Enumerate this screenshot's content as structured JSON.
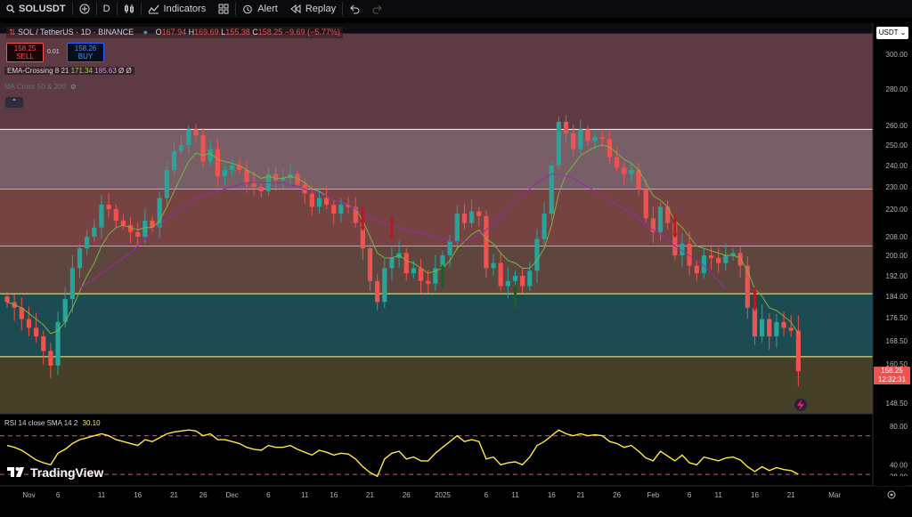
{
  "toolbar": {
    "symbol": "SOLUSDT",
    "interval": "D",
    "indicators": "Indicators",
    "alert": "Alert",
    "replay": "Replay"
  },
  "legend": {
    "title": "SOL / TetherUS · 1D · BINANCE",
    "open_label": "O",
    "open": "167.94",
    "high_label": "H",
    "high": "169.69",
    "low_label": "L",
    "low": "155.38",
    "close_label": "C",
    "close": "158.25",
    "change": "−9.69 (−5.77%)"
  },
  "trade": {
    "sell_price": "158.25",
    "sell_label": "SELL",
    "spread": "0.01",
    "buy_price": "158.26",
    "buy_label": "BUY"
  },
  "indicators": [
    {
      "name": "EMA-Crossing 8 21",
      "v1": "171.34",
      "v2": "185.63",
      "v3": "Ø Ø"
    },
    {
      "name": "MA Cross 50 & 200"
    }
  ],
  "price_axis": {
    "currency": "USDT",
    "ticks": [
      "300.00",
      "280.00",
      "260.00",
      "250.00",
      "240.00",
      "230.00",
      "220.00",
      "208.00",
      "200.00",
      "192.00",
      "184.00",
      "176.50",
      "168.50",
      "160.50",
      "148.50"
    ],
    "last_price": "158.25",
    "countdown": "12:32:31"
  },
  "rsi": {
    "label": "RSI 14 close SMA 14 2",
    "value": "30.10",
    "ticks": [
      "80.00",
      "40.00",
      "28.00"
    ]
  },
  "time_axis": {
    "labels": [
      "Nov",
      "6",
      "11",
      "16",
      "21",
      "26",
      "Dec",
      "6",
      "11",
      "16",
      "21",
      "26",
      "2025",
      "6",
      "11",
      "16",
      "21",
      "26",
      "Feb",
      "6",
      "11",
      "16",
      "21",
      "Mar"
    ]
  },
  "logo": "TradingView",
  "colors": {
    "up": "#26a69a",
    "down": "#ef5350",
    "ema_fast": "#7cb342",
    "ema_slow": "#9c27b0",
    "rsi": "#ffeb3b",
    "level_line": "#fff59d"
  },
  "chart_data": {
    "type": "candlestick",
    "symbol": "SOL / TetherUS",
    "interval": "1D",
    "price_range": [
      143,
      312
    ],
    "horizontal_levels": [
      258,
      229,
      204,
      185,
      163
    ],
    "zones": [
      {
        "from": 258,
        "to": 312,
        "color": "#7a4a55"
      },
      {
        "from": 229,
        "to": 258,
        "color": "#9c7a86"
      },
      {
        "from": 204,
        "to": 229,
        "color": "#9a5656"
      },
      {
        "from": 185,
        "to": 204,
        "color": "#7a5a50"
      },
      {
        "from": 163,
        "to": 185,
        "color": "#23606a"
      },
      {
        "from": 143,
        "to": 163,
        "color": "#5a5232"
      }
    ],
    "closes": [
      182,
      180,
      176,
      173,
      170,
      165,
      160,
      175,
      183,
      195,
      203,
      208,
      212,
      222,
      220,
      215,
      213,
      210,
      208,
      215,
      212,
      225,
      238,
      247,
      250,
      258,
      255,
      242,
      248,
      235,
      238,
      240,
      238,
      232,
      230,
      228,
      236,
      233,
      234,
      236,
      231,
      227,
      221,
      225,
      222,
      218,
      222,
      221,
      214,
      203,
      190,
      182,
      195,
      199,
      201,
      193,
      195,
      190,
      189,
      195,
      200,
      206,
      218,
      214,
      219,
      217,
      195,
      197,
      188,
      190,
      192,
      188,
      194,
      207,
      218,
      240,
      262,
      256,
      248,
      258,
      252,
      254,
      253,
      244,
      239,
      236,
      238,
      229,
      216,
      210,
      221,
      214,
      200,
      205,
      196,
      193,
      200,
      199,
      197,
      200,
      201,
      196,
      180,
      170,
      176,
      170,
      175,
      173,
      172,
      158.25
    ],
    "sell_signals": [
      49,
      53,
      92,
      103
    ],
    "buy_signals": [
      60,
      70
    ],
    "ema_fast": [
      182,
      181,
      180,
      178,
      176,
      174,
      171,
      172,
      175,
      180,
      186,
      192,
      197,
      204,
      209,
      212,
      213,
      212,
      211,
      212,
      212,
      215,
      221,
      228,
      235,
      242,
      246,
      245,
      246,
      243,
      242,
      241,
      240,
      238,
      236,
      234,
      235,
      234,
      234,
      235,
      234,
      232,
      229,
      228,
      226,
      224,
      223,
      222,
      220,
      215,
      208,
      201,
      199,
      199,
      200,
      198,
      197,
      195,
      193,
      194,
      195,
      198,
      203,
      206,
      209,
      211,
      207,
      205,
      201,
      198,
      197,
      195,
      195,
      198,
      203,
      213,
      227,
      236,
      240,
      245,
      247,
      249,
      250,
      249,
      246,
      243,
      241,
      238,
      232,
      226,
      224,
      221,
      215,
      212,
      208,
      204,
      203,
      202,
      201,
      200,
      200,
      199,
      194,
      187,
      184,
      180,
      179,
      177,
      175,
      171
    ],
    "ema_slow_start": 10,
    "ema_slow": [
      187,
      189,
      191,
      193,
      195,
      197,
      199,
      201,
      204,
      207,
      210,
      213,
      216,
      218,
      221,
      223,
      225,
      226,
      227,
      228,
      229,
      230,
      231,
      232,
      232,
      232,
      232,
      232,
      232,
      231,
      230,
      229,
      228,
      227,
      226,
      224,
      223,
      222,
      220,
      218,
      216,
      215,
      214,
      213,
      212,
      211,
      210,
      210,
      209,
      208,
      207,
      206,
      206,
      206,
      207,
      209,
      211,
      214,
      217,
      220,
      223,
      226,
      229,
      232,
      234,
      236,
      236,
      235,
      234,
      232,
      230,
      228,
      226,
      224,
      222,
      220,
      218,
      216,
      213,
      211,
      209,
      207,
      204,
      202,
      200,
      198,
      196,
      193,
      190,
      187
    ],
    "rsi_range": [
      20,
      90
    ],
    "rsi_levels": [
      70,
      30
    ],
    "rsi": [
      60,
      58,
      55,
      50,
      45,
      42,
      40,
      52,
      56,
      62,
      66,
      68,
      70,
      72,
      70,
      66,
      64,
      62,
      60,
      66,
      64,
      68,
      72,
      74,
      75,
      76,
      75,
      70,
      72,
      66,
      66,
      64,
      62,
      58,
      56,
      55,
      60,
      58,
      58,
      60,
      56,
      53,
      50,
      55,
      53,
      50,
      52,
      51,
      46,
      38,
      32,
      28,
      46,
      52,
      54,
      46,
      48,
      44,
      44,
      52,
      58,
      64,
      70,
      64,
      66,
      64,
      46,
      48,
      40,
      42,
      43,
      40,
      48,
      60,
      64,
      70,
      76,
      72,
      70,
      72,
      70,
      71,
      70,
      64,
      62,
      58,
      60,
      54,
      47,
      44,
      54,
      49,
      44,
      50,
      42,
      40,
      48,
      46,
      44,
      47,
      48,
      45,
      38,
      33,
      38,
      34,
      37,
      35,
      34,
      30.1
    ]
  }
}
